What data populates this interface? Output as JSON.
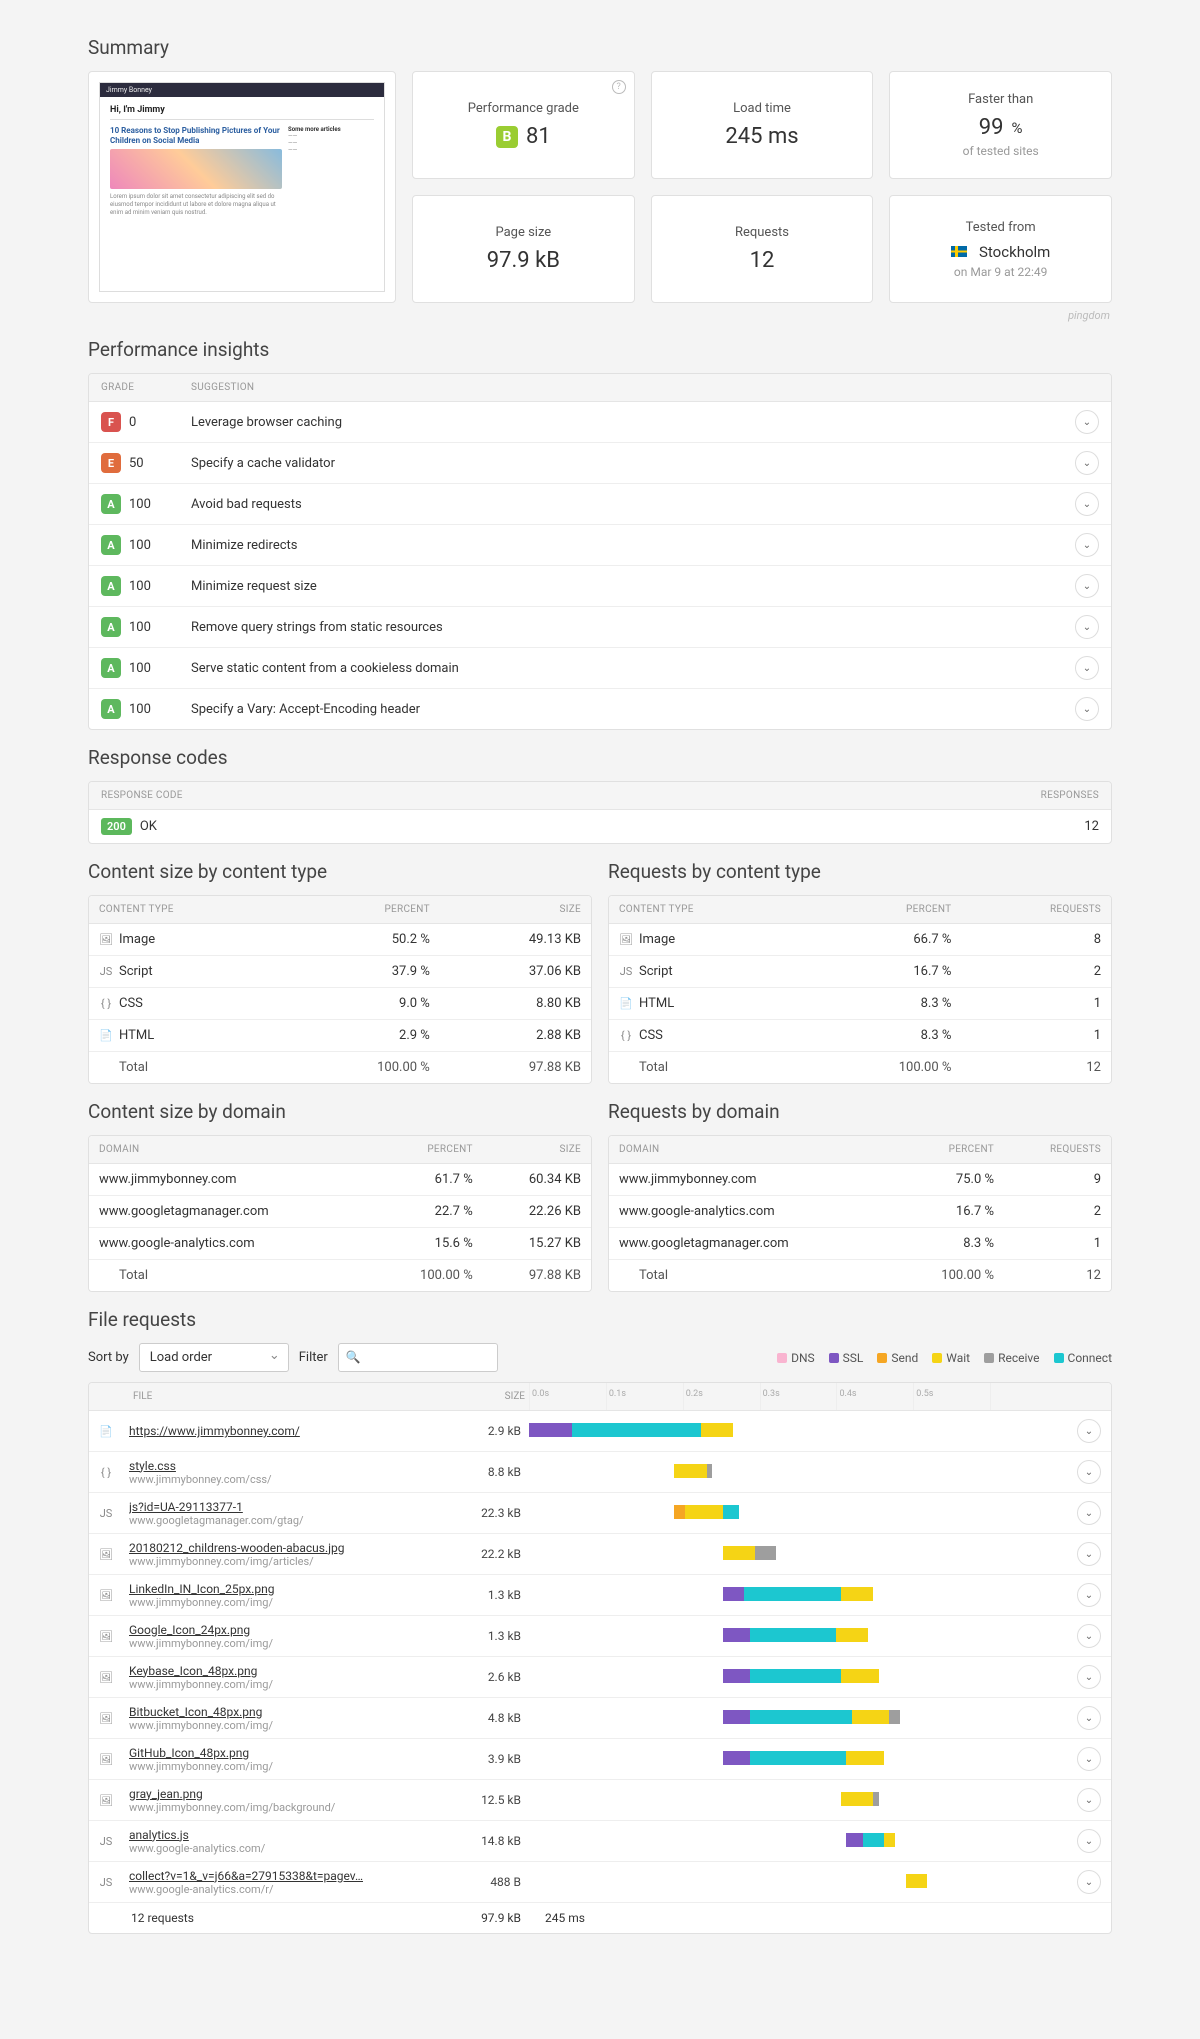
{
  "headings": {
    "summary": "Summary",
    "insights": "Performance insights",
    "response": "Response codes",
    "csize_type": "Content size by content type",
    "req_type": "Requests by content type",
    "csize_domain": "Content size by domain",
    "req_domain": "Requests by domain",
    "files": "File requests"
  },
  "brand": "pingdom",
  "thumbnail": {
    "site_name": "Jimmy Bonney",
    "greeting": "Hi, I'm Jimmy",
    "article": "10 Reasons to Stop Publishing Pictures of Your Children on Social Media"
  },
  "cards": {
    "perf": {
      "label": "Performance grade",
      "grade": "B",
      "score": "81"
    },
    "load": {
      "label": "Load time",
      "value": "245 ms"
    },
    "faster": {
      "label": "Faster than",
      "value": "99",
      "unit": "%",
      "sub": "of tested sites"
    },
    "page": {
      "label": "Page size",
      "value": "97.9 kB"
    },
    "req": {
      "label": "Requests",
      "value": "12"
    },
    "tested": {
      "label": "Tested from",
      "city": "Stockholm",
      "when": "on Mar 9 at 22:49"
    }
  },
  "insights_header": {
    "grade": "GRADE",
    "sugg": "SUGGESTION"
  },
  "insights": [
    {
      "g": "F",
      "score": "0",
      "text": "Leverage browser caching"
    },
    {
      "g": "E",
      "score": "50",
      "text": "Specify a cache validator"
    },
    {
      "g": "A",
      "score": "100",
      "text": "Avoid bad requests"
    },
    {
      "g": "A",
      "score": "100",
      "text": "Minimize redirects"
    },
    {
      "g": "A",
      "score": "100",
      "text": "Minimize request size"
    },
    {
      "g": "A",
      "score": "100",
      "text": "Remove query strings from static resources"
    },
    {
      "g": "A",
      "score": "100",
      "text": "Serve static content from a cookieless domain"
    },
    {
      "g": "A",
      "score": "100",
      "text": "Specify a Vary: Accept-Encoding header"
    }
  ],
  "response_header": {
    "code": "RESPONSE CODE",
    "resp": "RESPONSES"
  },
  "response_rows": [
    {
      "code": "200",
      "label": "OK",
      "count": "12"
    }
  ],
  "ct_head": {
    "ct": "CONTENT TYPE",
    "pct": "PERCENT",
    "size": "SIZE",
    "req": "REQUESTS"
  },
  "csize_type": [
    {
      "ic": "img",
      "name": "Image",
      "pct": "50.2 %",
      "size": "49.13 KB"
    },
    {
      "ic": "js",
      "name": "Script",
      "pct": "37.9 %",
      "size": "37.06 KB"
    },
    {
      "ic": "css",
      "name": "CSS",
      "pct": "9.0 %",
      "size": "8.80 KB"
    },
    {
      "ic": "html",
      "name": "HTML",
      "pct": "2.9 %",
      "size": "2.88 KB"
    }
  ],
  "csize_type_total": {
    "name": "Total",
    "pct": "100.00 %",
    "size": "97.88 KB"
  },
  "req_type": [
    {
      "ic": "img",
      "name": "Image",
      "pct": "66.7 %",
      "req": "8"
    },
    {
      "ic": "js",
      "name": "Script",
      "pct": "16.7 %",
      "req": "2"
    },
    {
      "ic": "html",
      "name": "HTML",
      "pct": "8.3 %",
      "req": "1"
    },
    {
      "ic": "css",
      "name": "CSS",
      "pct": "8.3 %",
      "req": "1"
    }
  ],
  "req_type_total": {
    "name": "Total",
    "pct": "100.00 %",
    "req": "12"
  },
  "dom_head": {
    "dom": "DOMAIN",
    "pct": "PERCENT",
    "size": "SIZE",
    "req": "REQUESTS"
  },
  "csize_domain": [
    {
      "name": "www.jimmybonney.com",
      "pct": "61.7 %",
      "size": "60.34 KB"
    },
    {
      "name": "www.googletagmanager.com",
      "pct": "22.7 %",
      "size": "22.26 KB"
    },
    {
      "name": "www.google-analytics.com",
      "pct": "15.6 %",
      "size": "15.27 KB"
    }
  ],
  "csize_domain_total": {
    "name": "Total",
    "pct": "100.00 %",
    "size": "97.88 KB"
  },
  "req_domain": [
    {
      "name": "www.jimmybonney.com",
      "pct": "75.0 %",
      "req": "9"
    },
    {
      "name": "www.google-analytics.com",
      "pct": "16.7 %",
      "req": "2"
    },
    {
      "name": "www.googletagmanager.com",
      "pct": "8.3 %",
      "req": "1"
    }
  ],
  "req_domain_total": {
    "name": "Total",
    "pct": "100.00 %",
    "req": "12"
  },
  "sort": {
    "label": "Sort by",
    "value": "Load order",
    "filter_label": "Filter",
    "filter_ph": ""
  },
  "legend": {
    "dns": "DNS",
    "ssl": "SSL",
    "send": "Send",
    "wait": "Wait",
    "recv": "Receive",
    "conn": "Connect"
  },
  "files_header": {
    "file": "FILE",
    "size": "SIZE"
  },
  "timeline_ticks": [
    "0.0s",
    "0.1s",
    "0.2s",
    "0.3s",
    "0.4s",
    "0.5s",
    ""
  ],
  "files": [
    {
      "ic": "html",
      "name": "https://www.jimmybonney.com/",
      "sub": "",
      "size": "2.9 kB",
      "segs": [
        {
          "c": "ssl",
          "l": 0,
          "w": 8
        },
        {
          "c": "conn",
          "l": 8,
          "w": 24
        },
        {
          "c": "wait",
          "l": 32,
          "w": 6
        }
      ]
    },
    {
      "ic": "css",
      "name": "style.css",
      "sub": "www.jimmybonney.com/css/",
      "size": "8.8 kB",
      "segs": [
        {
          "c": "wait",
          "l": 27,
          "w": 6
        },
        {
          "c": "recv",
          "l": 33,
          "w": 1
        }
      ]
    },
    {
      "ic": "js",
      "name": "js?id=UA-29113377-1",
      "sub": "www.googletagmanager.com/gtag/",
      "size": "22.3 kB",
      "segs": [
        {
          "c": "send",
          "l": 27,
          "w": 2
        },
        {
          "c": "wait",
          "l": 29,
          "w": 7
        },
        {
          "c": "conn",
          "l": 36,
          "w": 3
        }
      ]
    },
    {
      "ic": "img",
      "name": "20180212_childrens-wooden-abacus.jpg",
      "sub": "www.jimmybonney.com/img/articles/",
      "size": "22.2 kB",
      "segs": [
        {
          "c": "wait",
          "l": 36,
          "w": 6
        },
        {
          "c": "recv",
          "l": 42,
          "w": 4
        }
      ]
    },
    {
      "ic": "img",
      "name": "LinkedIn_IN_Icon_25px.png",
      "sub": "www.jimmybonney.com/img/",
      "size": "1.3 kB",
      "segs": [
        {
          "c": "ssl",
          "l": 36,
          "w": 4
        },
        {
          "c": "conn",
          "l": 40,
          "w": 18
        },
        {
          "c": "wait",
          "l": 58,
          "w": 6
        }
      ]
    },
    {
      "ic": "img",
      "name": "Google_Icon_24px.png",
      "sub": "www.jimmybonney.com/img/",
      "size": "1.3 kB",
      "segs": [
        {
          "c": "ssl",
          "l": 36,
          "w": 5
        },
        {
          "c": "conn",
          "l": 41,
          "w": 16
        },
        {
          "c": "wait",
          "l": 57,
          "w": 6
        }
      ]
    },
    {
      "ic": "img",
      "name": "Keybase_Icon_48px.png",
      "sub": "www.jimmybonney.com/img/",
      "size": "2.6 kB",
      "segs": [
        {
          "c": "ssl",
          "l": 36,
          "w": 5
        },
        {
          "c": "conn",
          "l": 41,
          "w": 17
        },
        {
          "c": "wait",
          "l": 58,
          "w": 7
        }
      ]
    },
    {
      "ic": "img",
      "name": "Bitbucket_Icon_48px.png",
      "sub": "www.jimmybonney.com/img/",
      "size": "4.8 kB",
      "segs": [
        {
          "c": "ssl",
          "l": 36,
          "w": 5
        },
        {
          "c": "conn",
          "l": 41,
          "w": 19
        },
        {
          "c": "wait",
          "l": 60,
          "w": 7
        },
        {
          "c": "recv",
          "l": 67,
          "w": 2
        }
      ]
    },
    {
      "ic": "img",
      "name": "GitHub_Icon_48px.png",
      "sub": "www.jimmybonney.com/img/",
      "size": "3.9 kB",
      "segs": [
        {
          "c": "ssl",
          "l": 36,
          "w": 5
        },
        {
          "c": "conn",
          "l": 41,
          "w": 18
        },
        {
          "c": "wait",
          "l": 59,
          "w": 7
        }
      ]
    },
    {
      "ic": "img",
      "name": "gray_jean.png",
      "sub": "www.jimmybonney.com/img/background/",
      "size": "12.5 kB",
      "segs": [
        {
          "c": "wait",
          "l": 58,
          "w": 6
        },
        {
          "c": "recv",
          "l": 64,
          "w": 1
        }
      ]
    },
    {
      "ic": "js",
      "name": "analytics.js",
      "sub": "www.google-analytics.com/",
      "size": "14.8 kB",
      "segs": [
        {
          "c": "ssl",
          "l": 59,
          "w": 3
        },
        {
          "c": "conn",
          "l": 62,
          "w": 4
        },
        {
          "c": "wait",
          "l": 66,
          "w": 2
        }
      ]
    },
    {
      "ic": "js",
      "name": "collect?v=1&_v=j66&a=27915338&t=pagev…",
      "sub": "www.google-analytics.com/r/",
      "size": "488 B",
      "segs": [
        {
          "c": "wait",
          "l": 70,
          "w": 4
        }
      ]
    }
  ],
  "files_footer": {
    "count": "12 requests",
    "size": "97.9 kB",
    "time": "245 ms"
  },
  "icons": {
    "img": "🖼",
    "js": "JS",
    "css": "{ }",
    "html": "📄"
  }
}
